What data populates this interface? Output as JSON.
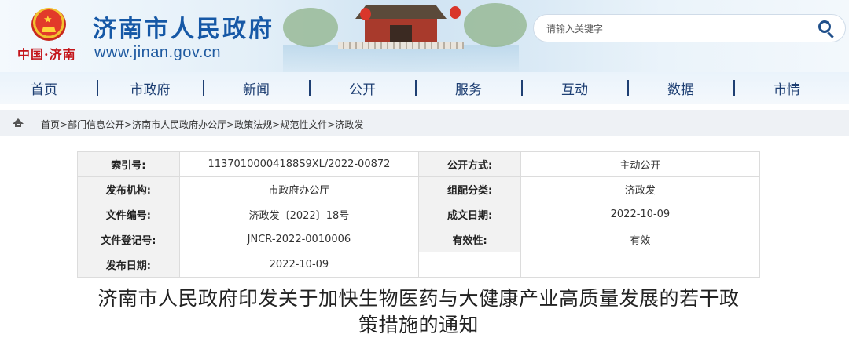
{
  "header": {
    "site_title": "济南市人民政府",
    "site_url": "www.jinan.gov.cn",
    "brand_sub": "中国·济南",
    "emblem_star": "★",
    "search": {
      "placeholder": "请输入关键字"
    }
  },
  "nav": {
    "items": [
      {
        "label": "首页"
      },
      {
        "label": "市政府"
      },
      {
        "label": "新闻"
      },
      {
        "label": "公开"
      },
      {
        "label": "服务"
      },
      {
        "label": "互动"
      },
      {
        "label": "数据"
      },
      {
        "label": "市情"
      }
    ]
  },
  "breadcrumb": {
    "items": [
      "首页",
      "部门信息公开",
      "济南市人民政府办公厅",
      "政策法规",
      "规范性文件",
      "济政发"
    ],
    "separator": ">"
  },
  "info_table": {
    "rows": [
      {
        "k1": "索引号:",
        "v1": "11370100004188S9XL/2022-00872",
        "k2": "公开方式:",
        "v2": "主动公开"
      },
      {
        "k1": "发布机构:",
        "v1": "市政府办公厅",
        "k2": "组配分类:",
        "v2": "济政发"
      },
      {
        "k1": "文件编号:",
        "v1": "济政发〔2022〕18号",
        "k2": "成文日期:",
        "v2": "2022-10-09"
      },
      {
        "k1": "文件登记号:",
        "v1": "JNCR-2022-0010006",
        "k2": "有效性:",
        "v2": "有效"
      },
      {
        "k1": "发布日期:",
        "v1": "2022-10-09",
        "k2": "",
        "v2": ""
      }
    ]
  },
  "article": {
    "title_line1": "济南市人民政府印发关于加快生物医药与大健康产业高质量发展的若干政",
    "title_line2": "策措施的通知"
  }
}
